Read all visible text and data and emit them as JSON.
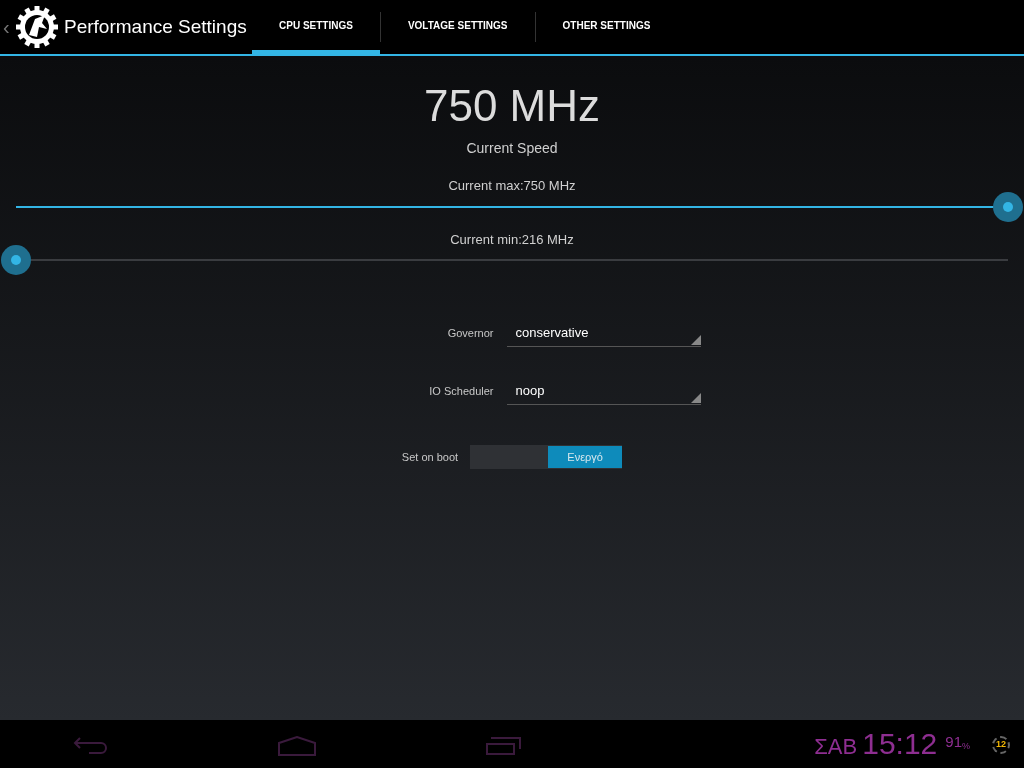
{
  "action_bar": {
    "up_caret": "‹",
    "title": "Performance Settings"
  },
  "tabs": [
    {
      "label": "CPU SETTINGS",
      "selected": true
    },
    {
      "label": "VOLTAGE SETTINGS",
      "selected": false
    },
    {
      "label": "OTHER SETTINGS",
      "selected": false
    }
  ],
  "speed": {
    "value": "750 MHz",
    "caption": "Current Speed"
  },
  "sliders": [
    {
      "label": "Current max:750 MHz",
      "level": 1.0
    },
    {
      "label": "Current min:216 MHz",
      "level": 0.0
    }
  ],
  "dropdowns": [
    {
      "label": "Governor",
      "value": "conservative"
    },
    {
      "label": "IO Scheduler",
      "value": "noop"
    }
  ],
  "boot_switch": {
    "label": "Set on boot",
    "on": true,
    "on_text": "Ενεργό"
  },
  "status_bar": {
    "day": "ΣΑΒ",
    "time": "15:12",
    "battery": "91",
    "battery_unit": "%",
    "badge": "12"
  }
}
